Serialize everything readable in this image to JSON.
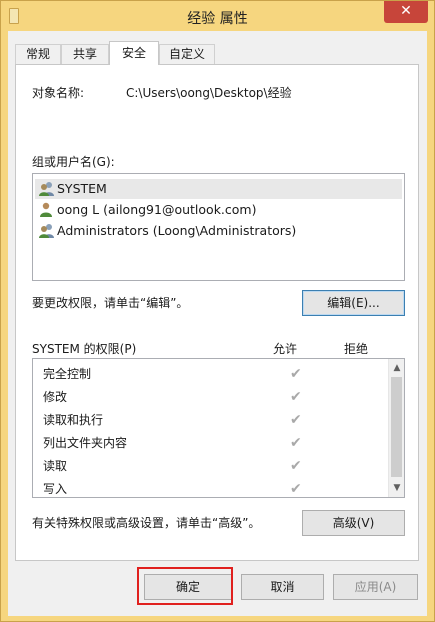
{
  "window": {
    "title": "经验 属性",
    "close_glyph": "✕"
  },
  "tabs": [
    {
      "label": "常规",
      "active": false
    },
    {
      "label": "共享",
      "active": false
    },
    {
      "label": "安全",
      "active": true
    },
    {
      "label": "自定义",
      "active": false
    }
  ],
  "security": {
    "object_name_label": "对象名称:",
    "object_name_value": "C:\\Users\\oong\\Desktop\\经验",
    "groups_label": "组或用户名(G):",
    "users": [
      {
        "name": "SYSTEM",
        "icon": "group-users-icon",
        "selected": true
      },
      {
        "name": "oong L (ailong91@outlook.com)",
        "icon": "single-user-icon",
        "selected": false
      },
      {
        "name": "Administrators (Loong\\Administrators)",
        "icon": "group-users-icon",
        "selected": false
      }
    ],
    "edit_hint": "要更改权限，请单击“编辑”。",
    "edit_button": "编辑(E)...",
    "permissions_title": "SYSTEM 的权限(P)",
    "allow_header": "允许",
    "deny_header": "拒绝",
    "permissions": [
      {
        "name": "完全控制",
        "allow": true,
        "deny": false
      },
      {
        "name": "修改",
        "allow": true,
        "deny": false
      },
      {
        "name": "读取和执行",
        "allow": true,
        "deny": false
      },
      {
        "name": "列出文件夹内容",
        "allow": true,
        "deny": false
      },
      {
        "name": "读取",
        "allow": true,
        "deny": false
      },
      {
        "name": "写入",
        "allow": true,
        "deny": false
      }
    ],
    "check_glyph": "✔",
    "advanced_hint": "有关特殊权限或高级设置，请单击“高级”。",
    "advanced_button": "高级(V)"
  },
  "footer": {
    "ok_button": "确定",
    "cancel_button": "取消",
    "apply_button": "应用(A)"
  },
  "colors": {
    "frame": "#f6d67f",
    "close": "#c7453a",
    "highlight_box": "#e0201e"
  }
}
